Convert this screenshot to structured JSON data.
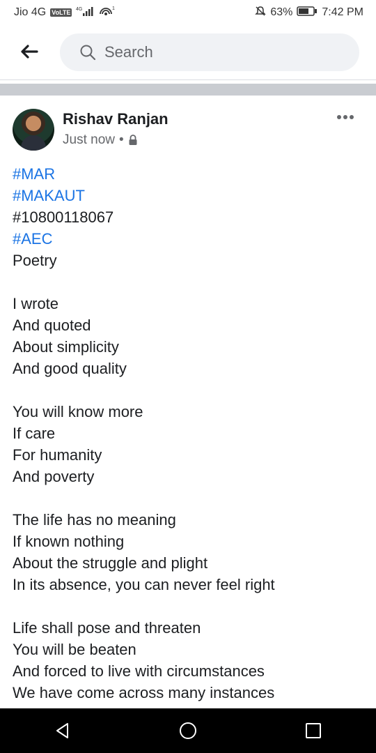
{
  "status_bar": {
    "carrier": "Jio 4G",
    "volte": "VoLTE",
    "network": "4G",
    "battery": "63%",
    "time": "7:42 PM",
    "icons": [
      "signal-icon",
      "hotspot-icon",
      "mute-icon",
      "battery-icon"
    ]
  },
  "header": {
    "back_icon": "back-arrow-icon",
    "search_placeholder": "Search",
    "search_icon": "search-icon"
  },
  "post": {
    "author": "Rishav Ranjan",
    "timestamp": "Just now",
    "separator": "•",
    "privacy_icon": "lock-icon",
    "more_icon": "more-options-icon",
    "lines": [
      {
        "text": "#MAR",
        "hashtag": true
      },
      {
        "text": "#MAKAUT",
        "hashtag": true
      },
      {
        "text": "#10800118067",
        "hashtag": false
      },
      {
        "text": "#AEC",
        "hashtag": true
      },
      {
        "text": "Poetry",
        "hashtag": false
      },
      {
        "text": "",
        "hashtag": false
      },
      {
        "text": "I wrote",
        "hashtag": false
      },
      {
        "text": "And quoted",
        "hashtag": false
      },
      {
        "text": "About simplicity",
        "hashtag": false
      },
      {
        "text": "And good quality",
        "hashtag": false
      },
      {
        "text": "",
        "hashtag": false
      },
      {
        "text": "You will know more",
        "hashtag": false
      },
      {
        "text": "If care",
        "hashtag": false
      },
      {
        "text": "For humanity",
        "hashtag": false
      },
      {
        "text": "And poverty",
        "hashtag": false
      },
      {
        "text": "",
        "hashtag": false
      },
      {
        "text": "The life has no meaning",
        "hashtag": false
      },
      {
        "text": "If known nothing",
        "hashtag": false
      },
      {
        "text": "About the struggle and plight",
        "hashtag": false
      },
      {
        "text": "In its absence, you can never feel right",
        "hashtag": false
      },
      {
        "text": "",
        "hashtag": false
      },
      {
        "text": "Life shall pose and threaten",
        "hashtag": false
      },
      {
        "text": "You will be beaten",
        "hashtag": false
      },
      {
        "text": "And forced to live with circumstances",
        "hashtag": false
      },
      {
        "text": "We have come across many instances",
        "hashtag": false
      }
    ]
  },
  "nav_bar": {
    "buttons": [
      "back-triangle-icon",
      "home-circle-icon",
      "recents-square-icon"
    ]
  },
  "colors": {
    "hashtag": "#1b74e4",
    "text": "#1c1e21",
    "secondary": "#65676b",
    "divider": "#c9ccd1",
    "search_bg": "#f0f2f5"
  }
}
